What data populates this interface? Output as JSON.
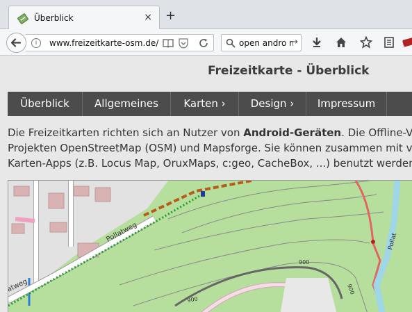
{
  "browser": {
    "tab": {
      "title": "Überblick",
      "close_glyph": "×"
    },
    "new_tab_glyph": "+",
    "url": "www.freizeitkarte-osm.de/",
    "search_text": "open andro m",
    "search_go_glyph": "→",
    "info_glyph": "i",
    "icons": [
      "favicon-map-icon",
      "back-arrow-icon",
      "info-icon",
      "reader-view-icon",
      "pocket-icon",
      "reload-icon",
      "search-icon",
      "download-icon",
      "home-icon",
      "bookmark-star-icon",
      "bookmarks-list-icon",
      "extension-icon"
    ]
  },
  "page": {
    "title": "Freizeitkarte - Überblick",
    "menu": [
      {
        "label": "Überblick"
      },
      {
        "label": "Allgemeines"
      },
      {
        "label": "Karten ›"
      },
      {
        "label": "Design ›"
      },
      {
        "label": "Impressum"
      }
    ],
    "intro": {
      "line1_pre": "Die Freizeitkarten richten sich an Nutzer von ",
      "line1_bold": "Android-Geräten",
      "line1_post": ". Die Offline-Vekto",
      "line2": "Projekten OpenStreetMap (OSM) und Mapsforge. Sie können zusammen mit versch",
      "line3": "Karten-Apps (z.B. Locus Map, OruxMaps, c:geo, CacheBox, ...) benutzt werden."
    },
    "map": {
      "street_label": "Pollatweg",
      "street_label_cut": "atweg",
      "river_label": "Pollat",
      "contour_labels": [
        "900",
        "900",
        "900"
      ],
      "colors": {
        "forest": "#b6de9c",
        "meadow": "#cde8b5",
        "building": "#d9b3b3",
        "road_brown": "#b85c1a",
        "path_green": "#1f9c2a",
        "river": "#9fd6e8",
        "red_path": "#e06666"
      }
    }
  }
}
